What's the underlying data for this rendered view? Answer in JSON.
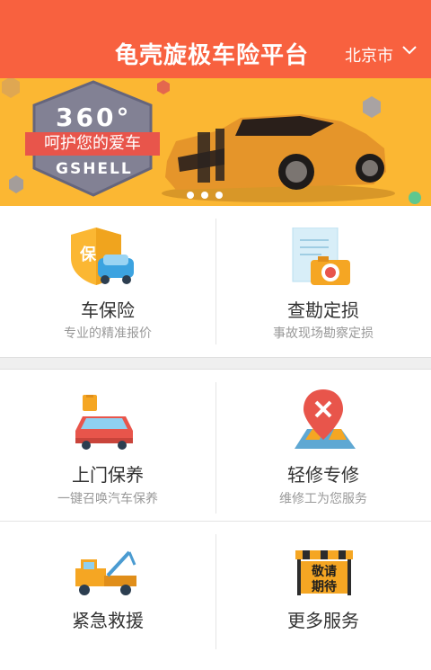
{
  "header": {
    "title": "龟壳旋极车险平台",
    "city": "北京市",
    "background": "#f8613f"
  },
  "banner": {
    "badge_top": "360°",
    "badge_ribbon": "呵护您的爱车",
    "badge_brand": "GSHELL",
    "background": "#fbb733",
    "slide_count": 3
  },
  "services": [
    {
      "title": "车保险",
      "subtitle": "专业的精准报价",
      "icon": "shield-car-icon"
    },
    {
      "title": "查勘定损",
      "subtitle": "事故现场勘察定损",
      "icon": "document-camera-icon"
    },
    {
      "title": "上门保养",
      "subtitle": "一键召唤汽车保养",
      "icon": "car-oil-icon"
    },
    {
      "title": "轻修专修",
      "subtitle": "维修工为您服务",
      "icon": "map-pin-tools-icon"
    },
    {
      "title": "紧急救援",
      "title_only": true,
      "icon": "tow-truck-icon"
    },
    {
      "title": "更多服务",
      "title_only": true,
      "icon": "coming-soon-sign-icon",
      "sign_text_1": "敬请",
      "sign_text_2": "期待"
    }
  ]
}
